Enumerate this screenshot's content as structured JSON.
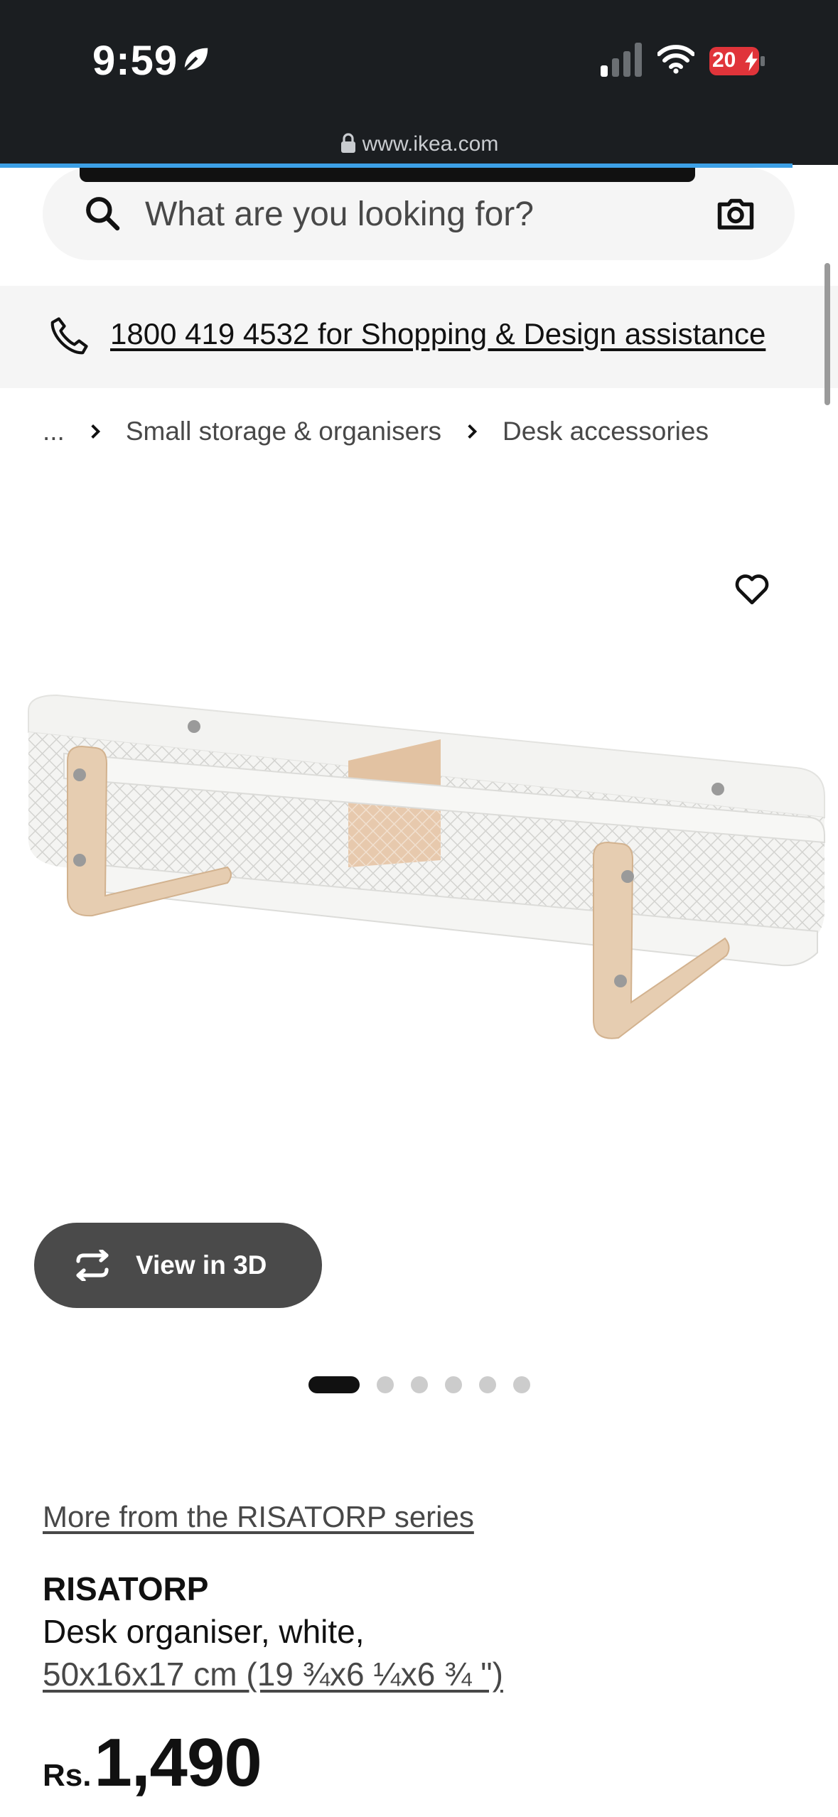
{
  "status_bar": {
    "time": "9:59",
    "battery": "20"
  },
  "browser": {
    "url": "www.ikea.com"
  },
  "search": {
    "placeholder": "What are you looking for?"
  },
  "assistance": {
    "text": "1800 419 4532 for Shopping & Design assistance"
  },
  "breadcrumb": {
    "ellipsis": "...",
    "items": [
      "Small storage & organisers",
      "Desk accessories"
    ]
  },
  "gallery": {
    "view3d_label": "View in 3D",
    "dot_count": 6,
    "active_index": 0
  },
  "product": {
    "series_link": "More from the RISATORP series",
    "name": "RISATORP",
    "description": "Desk organiser, white,",
    "size": "50x16x17 cm (19 ¾x6 ¼x6 ¾ \")",
    "currency": "Rs.",
    "price": "1,490"
  },
  "colors": {
    "status_bar_bg": "#1b1e21",
    "progress": "#3da0e6",
    "battery": "#e0343a",
    "view3d_bg": "#4a4a4a"
  }
}
